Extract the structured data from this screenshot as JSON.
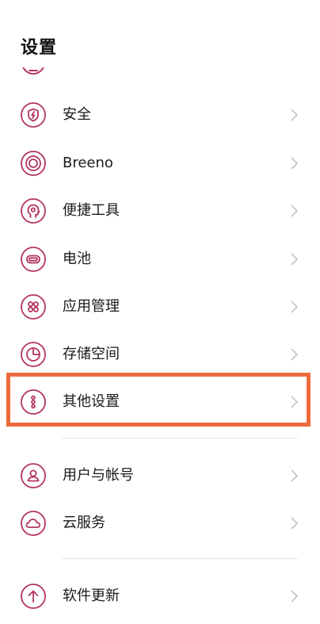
{
  "header": {
    "title": "设置"
  },
  "colors": {
    "accent": "#b5345c",
    "highlight": "#ee6a3c",
    "chevron": "#c4c4c4"
  },
  "settings_items": [
    {
      "label": "安全",
      "icon": "shield-lightning-icon"
    },
    {
      "label": "Breeno",
      "icon": "breeno-circle-icon"
    },
    {
      "label": "便捷工具",
      "icon": "head-gear-icon"
    },
    {
      "label": "电池",
      "icon": "battery-icon"
    },
    {
      "label": "应用管理",
      "icon": "app-grid-icon"
    },
    {
      "label": "存储空间",
      "icon": "storage-pie-icon"
    },
    {
      "label": "其他设置",
      "icon": "more-dots-icon",
      "highlighted": true
    },
    {
      "label": "用户与帐号",
      "icon": "user-account-icon"
    },
    {
      "label": "云服务",
      "icon": "cloud-icon"
    },
    {
      "label": "软件更新",
      "icon": "update-arrow-icon"
    }
  ]
}
